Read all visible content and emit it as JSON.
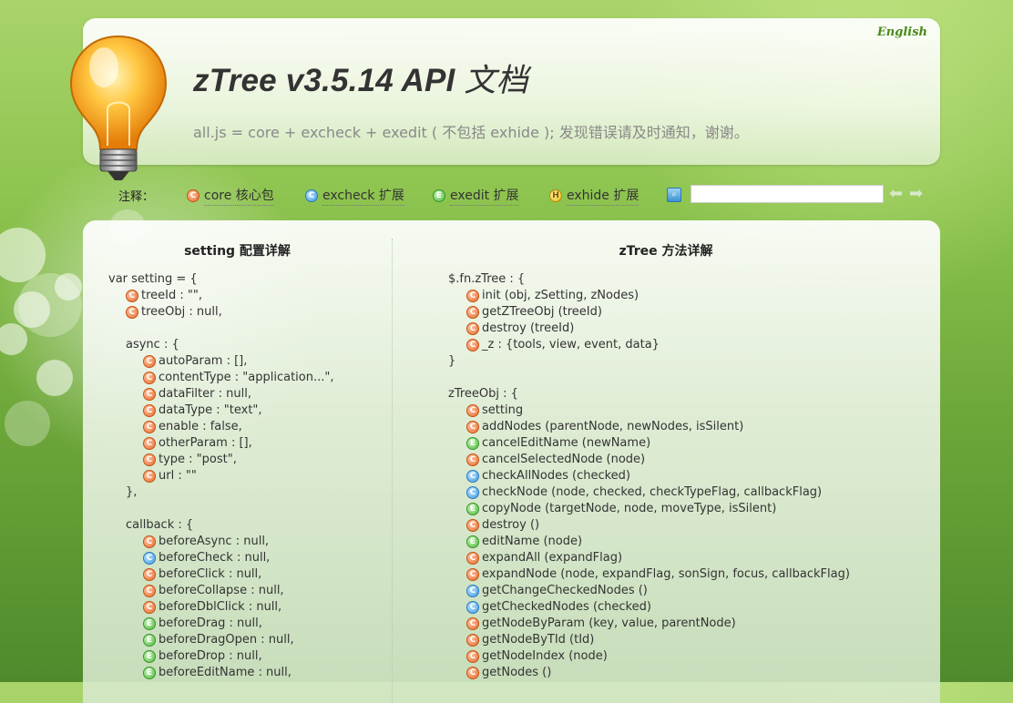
{
  "header": {
    "lang_link": "English",
    "title_main": "zTree v3.5.14 API ",
    "title_cn": "文档",
    "subtitle": "all.js = core + excheck + exedit ( 不包括 exhide ); 发现错误请及时通知，谢谢。"
  },
  "legend": {
    "label": "注释：",
    "items": [
      {
        "badge": "C",
        "type": "core",
        "text": "core 核心包"
      },
      {
        "badge": "C",
        "type": "excheck",
        "text": "excheck 扩展"
      },
      {
        "badge": "E",
        "type": "exedit",
        "text": "exedit 扩展"
      },
      {
        "badge": "H",
        "type": "exhide",
        "text": "exhide 扩展"
      }
    ],
    "search_value": "",
    "prev_arrow": "⬅",
    "next_arrow": "➡"
  },
  "left_column": {
    "title": "setting 配置详解",
    "lines": [
      {
        "indent": 0,
        "badge": null,
        "text": "var setting = {"
      },
      {
        "indent": 1,
        "badge": "core",
        "text": "treeId : \"\","
      },
      {
        "indent": 1,
        "badge": "core",
        "text": "treeObj : null,"
      },
      {
        "indent": 0,
        "badge": null,
        "text": ""
      },
      {
        "indent": 1,
        "badge": null,
        "text": "async : {"
      },
      {
        "indent": 2,
        "badge": "core",
        "text": "autoParam : [],"
      },
      {
        "indent": 2,
        "badge": "core",
        "text": "contentType : \"application...\","
      },
      {
        "indent": 2,
        "badge": "core",
        "text": "dataFilter : null,"
      },
      {
        "indent": 2,
        "badge": "core",
        "text": "dataType : \"text\","
      },
      {
        "indent": 2,
        "badge": "core",
        "text": "enable : false,"
      },
      {
        "indent": 2,
        "badge": "core",
        "text": "otherParam : [],"
      },
      {
        "indent": 2,
        "badge": "core",
        "text": "type : \"post\","
      },
      {
        "indent": 2,
        "badge": "core",
        "text": "url : \"\""
      },
      {
        "indent": 1,
        "badge": null,
        "text": "},"
      },
      {
        "indent": 0,
        "badge": null,
        "text": ""
      },
      {
        "indent": 1,
        "badge": null,
        "text": "callback : {"
      },
      {
        "indent": 2,
        "badge": "core",
        "text": "beforeAsync : null,"
      },
      {
        "indent": 2,
        "badge": "excheck",
        "text": "beforeCheck : null,"
      },
      {
        "indent": 2,
        "badge": "core",
        "text": "beforeClick : null,"
      },
      {
        "indent": 2,
        "badge": "core",
        "text": "beforeCollapse : null,"
      },
      {
        "indent": 2,
        "badge": "core",
        "text": "beforeDblClick : null,"
      },
      {
        "indent": 2,
        "badge": "exedit",
        "text": "beforeDrag : null,"
      },
      {
        "indent": 2,
        "badge": "exedit",
        "text": "beforeDragOpen : null,"
      },
      {
        "indent": 2,
        "badge": "exedit",
        "text": "beforeDrop : null,"
      },
      {
        "indent": 2,
        "badge": "exedit",
        "text": "beforeEditName : null,"
      }
    ]
  },
  "right_column": {
    "title": "zTree 方法详解",
    "lines": [
      {
        "indent": 0,
        "badge": null,
        "text": "$.fn.zTree : {"
      },
      {
        "indent": 1,
        "badge": "core",
        "text": "init (obj, zSetting, zNodes)"
      },
      {
        "indent": 1,
        "badge": "core",
        "text": "getZTreeObj (treeId)"
      },
      {
        "indent": 1,
        "badge": "core",
        "text": "destroy (treeId)"
      },
      {
        "indent": 1,
        "badge": "core",
        "text": "_z : {tools, view, event, data}"
      },
      {
        "indent": 0,
        "badge": null,
        "text": "}"
      },
      {
        "indent": 0,
        "badge": null,
        "text": ""
      },
      {
        "indent": 0,
        "badge": null,
        "text": "zTreeObj : {"
      },
      {
        "indent": 1,
        "badge": "core",
        "text": "setting"
      },
      {
        "indent": 1,
        "badge": "core",
        "text": "addNodes (parentNode, newNodes, isSilent)"
      },
      {
        "indent": 1,
        "badge": "exedit",
        "text": "cancelEditName (newName)"
      },
      {
        "indent": 1,
        "badge": "core",
        "text": "cancelSelectedNode (node)"
      },
      {
        "indent": 1,
        "badge": "excheck",
        "text": "checkAllNodes (checked)"
      },
      {
        "indent": 1,
        "badge": "excheck",
        "text": "checkNode (node, checked, checkTypeFlag, callbackFlag)"
      },
      {
        "indent": 1,
        "badge": "exedit",
        "text": "copyNode (targetNode, node, moveType, isSilent)"
      },
      {
        "indent": 1,
        "badge": "core",
        "text": "destroy ()"
      },
      {
        "indent": 1,
        "badge": "exedit",
        "text": "editName (node)"
      },
      {
        "indent": 1,
        "badge": "core",
        "text": "expandAll (expandFlag)"
      },
      {
        "indent": 1,
        "badge": "core",
        "text": "expandNode (node, expandFlag, sonSign, focus, callbackFlag)"
      },
      {
        "indent": 1,
        "badge": "excheck",
        "text": "getChangeCheckedNodes ()"
      },
      {
        "indent": 1,
        "badge": "excheck",
        "text": "getCheckedNodes (checked)"
      },
      {
        "indent": 1,
        "badge": "core",
        "text": "getNodeByParam (key, value, parentNode)"
      },
      {
        "indent": 1,
        "badge": "core",
        "text": "getNodeByTId (tId)"
      },
      {
        "indent": 1,
        "badge": "core",
        "text": "getNodeIndex (node)"
      },
      {
        "indent": 1,
        "badge": "core",
        "text": "getNodes ()"
      }
    ]
  },
  "badge_letters": {
    "core": "C",
    "excheck": "C",
    "exedit": "E",
    "exhide": "H"
  },
  "colors": {
    "core": "#e76a2d",
    "excheck": "#3c99e0",
    "exedit": "#4dbb3c",
    "exhide": "#e5b710",
    "link": "#4a8a1d"
  }
}
